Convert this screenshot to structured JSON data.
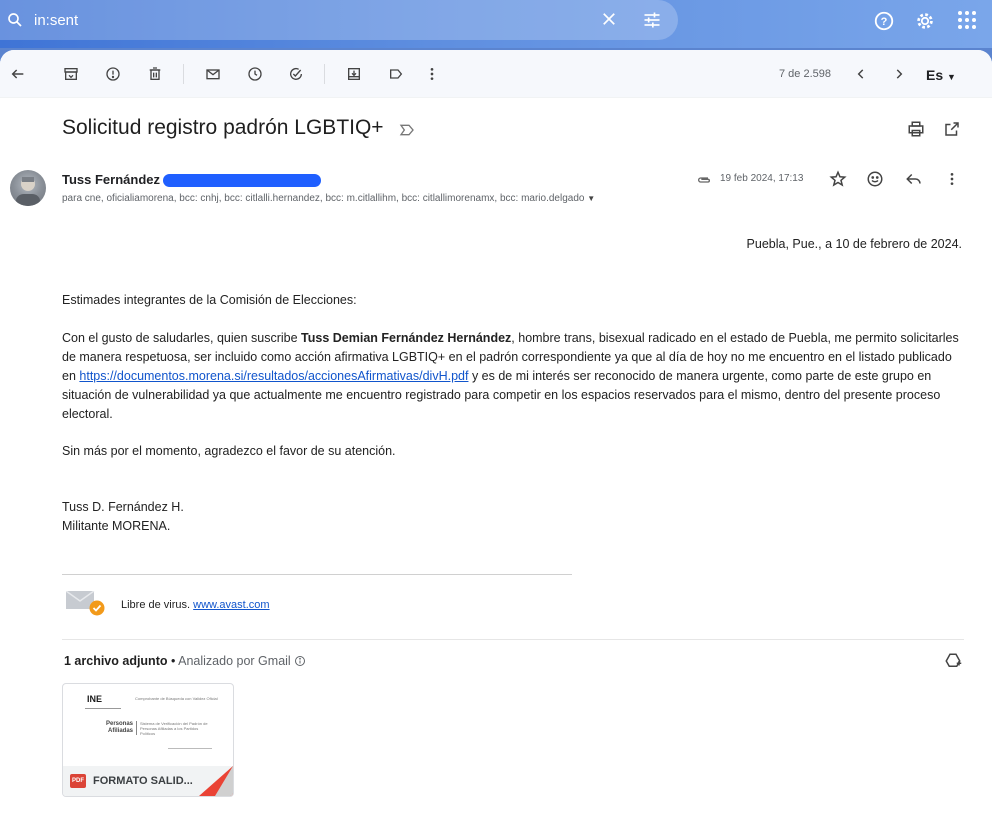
{
  "search": {
    "query": "in:sent"
  },
  "toolbar": {
    "count": "7 de 2.598",
    "lang": "Es"
  },
  "email": {
    "subject": "Solicitud registro padrón LGBTIQ+",
    "sender": "Tuss Fernández",
    "recipients": "para cne, oficialiamorena, bcc: cnhj, bcc: citlalli.hernandez, bcc: m.citlallihm, bcc: citlallimorenamx, bcc: mario.delgado",
    "date": "19 feb 2024, 17:13",
    "place_date": "Puebla, Pue., a 10 de febrero de 2024.",
    "greeting": "Estimades integrantes de la Comisión de Elecciones:",
    "p1_a": "Con el gusto de saludarles, quien suscribe ",
    "p1_name": "Tuss Demian Fernández Hernández",
    "p1_b": ", hombre trans, bisexual radicado en el estado de Puebla, me permito solicitarles de manera respetuosa, ser incluido como acción afirmativa LGBTIQ+ en el padrón correspondiente ya que al día de hoy no me encuentro en el listado publicado en ",
    "p1_link": "https://documentos.morena.si/resultados/accionesAfirmativas/divH.pdf",
    "p1_c": " y es de mi interés ser reconocido de manera urgente, como parte de este grupo en situación de vulnerabilidad ya que actualmente me encuentro registrado para competir en los espacios reservados para el mismo, dentro del presente proceso electoral.",
    "closing": "Sin más por el momento, agradezco el favor de su atención.",
    "sig_name": "Tuss D. Fernández H.",
    "sig_role": "Militante MORENA."
  },
  "virus": {
    "text": "Libre de virus.",
    "link": "www.avast.com"
  },
  "attachments": {
    "title": "1 archivo adjunto",
    "sep": " • ",
    "scan": "Analizado por Gmail",
    "file": {
      "name": "FORMATO SALID...",
      "badge": "PDF",
      "preview_logo": "INE",
      "preview_heading": "Comprobante de Búsqueda con Validez Oficial",
      "preview_left": "Personas Afiliadas",
      "preview_right": "Sistema de Verificación del Padrón de Personas Afiliadas a los Partidos Políticos"
    }
  },
  "colors": {
    "accent": "#3f74d6",
    "link": "#1155cc",
    "pdf": "#db4437",
    "redaction": "#1f5fff"
  }
}
